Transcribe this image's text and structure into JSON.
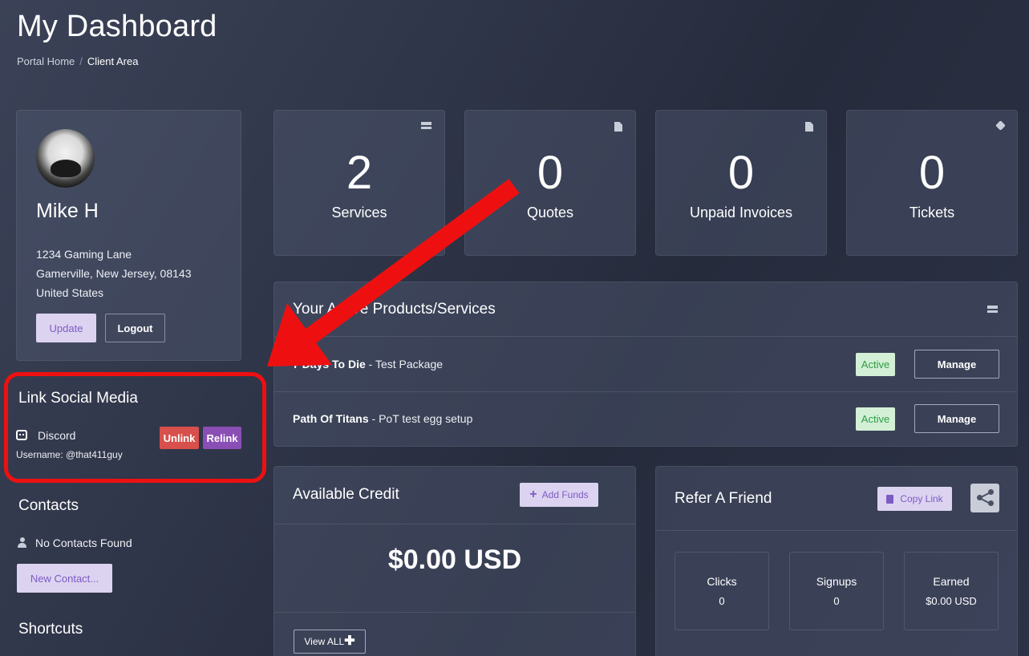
{
  "header": {
    "title": "My Dashboard",
    "breadcrumb": {
      "home": "Portal Home",
      "separator": "/",
      "current": "Client Area"
    }
  },
  "profile": {
    "name": "Mike H",
    "address": [
      "1234 Gaming Lane",
      "Gamerville, New Jersey, 08143",
      "United States"
    ],
    "update_label": "Update",
    "logout_label": "Logout"
  },
  "social": {
    "title": "Link Social Media",
    "service": "Discord",
    "username": "Username: @that411guy",
    "unlink_label": "Unlink",
    "relink_label": "Relink"
  },
  "contacts": {
    "title": "Contacts",
    "empty_text": "No Contacts Found",
    "new_label": "New Contact..."
  },
  "shortcuts": {
    "title": "Shortcuts"
  },
  "tiles": [
    {
      "value": "2",
      "label": "Services",
      "icon": "server-icon"
    },
    {
      "value": "0",
      "label": "Quotes",
      "icon": "document-icon"
    },
    {
      "value": "0",
      "label": "Unpaid Invoices",
      "icon": "document-icon"
    },
    {
      "value": "0",
      "label": "Tickets",
      "icon": "tag-icon"
    }
  ],
  "products": {
    "title": "Your Active Products/Services",
    "rows": [
      {
        "name": "7 Days To Die",
        "detail": " - Test Package",
        "status": "Active",
        "action": "Manage"
      },
      {
        "name": "Path Of Titans",
        "detail": " - PoT test egg setup",
        "status": "Active",
        "action": "Manage"
      }
    ]
  },
  "credit": {
    "title": "Available Credit",
    "add_funds_label": "Add Funds",
    "amount": "$0.00 USD",
    "view_all_label": "View ALL"
  },
  "refer": {
    "title": "Refer A Friend",
    "copy_label": "Copy Link",
    "stats": [
      {
        "label": "Clicks",
        "value": "0"
      },
      {
        "label": "Signups",
        "value": "0"
      },
      {
        "label": "Earned",
        "value": "$0.00 USD"
      }
    ]
  },
  "colors": {
    "accent_purple": "#7d5bc4",
    "button_light_purple": "#dcd3f0",
    "danger_red": "#d7504b",
    "relink_purple": "#8a4fb5",
    "active_green": "#2e9b45",
    "annotation_red": "#ee1010"
  }
}
